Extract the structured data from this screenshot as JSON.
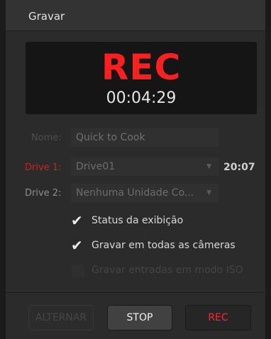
{
  "header": {
    "title": "Gravar"
  },
  "display": {
    "status": "REC",
    "timecode": "00:04:29",
    "status_color": "#ff1f1f"
  },
  "fields": {
    "name_label": "Nome:",
    "name_value": "Quick to Cook",
    "drive1_label": "Drive 1:",
    "drive1_value": "Drive01",
    "drive1_remaining": "20:07",
    "drive2_label": "Drive 2:",
    "drive2_value": "Nenhuma Unidade Co..."
  },
  "options": [
    {
      "label": "Status da exibição",
      "checked": true,
      "enabled": true
    },
    {
      "label": "Gravar em todas as câmeras",
      "checked": true,
      "enabled": true
    },
    {
      "label": "Gravar entradas em modo ISO",
      "checked": false,
      "enabled": false
    }
  ],
  "buttons": {
    "toggle_label": "ALTERNAR",
    "stop_label": "STOP",
    "rec_label": "REC"
  },
  "icons": {
    "dropdown": "chevron-down-icon",
    "check": "checkmark-icon"
  },
  "colors": {
    "accent_red": "#ff1f1f",
    "panel_bg": "#2b2b2b"
  }
}
